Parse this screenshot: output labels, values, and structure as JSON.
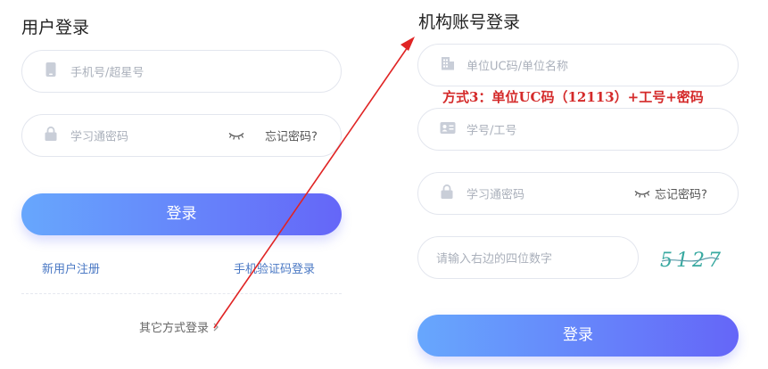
{
  "user_login": {
    "title": "用户登录",
    "phone_placeholder": "手机号/超星号",
    "password_placeholder": "学习通密码",
    "forgot_label": "忘记密码?",
    "login_label": "登录",
    "register_link": "新用户注册",
    "sms_link": "手机验证码登录",
    "other_methods": "其它方式登录"
  },
  "org_login": {
    "title": "机构账号登录",
    "uc_placeholder": "单位UC码/单位名称",
    "annotation": "方式3：单位UC码（12113）+工号+密码",
    "id_placeholder": "学号/工号",
    "password_placeholder": "学习通密码",
    "forgot_label": "忘记密码?",
    "captcha_placeholder": "请输入右边的四位数字",
    "captcha_code": "5127",
    "login_label": "登录"
  },
  "colors": {
    "accent_start": "#67a7fd",
    "accent_end": "#6566f8",
    "annotation": "#d42a2a",
    "link": "#4a78c4",
    "arrow": "#e02424"
  },
  "icons": [
    "phone-icon",
    "lock-icon",
    "eye-closed-icon",
    "building-icon",
    "id-card-icon",
    "chevron-right-icon"
  ]
}
